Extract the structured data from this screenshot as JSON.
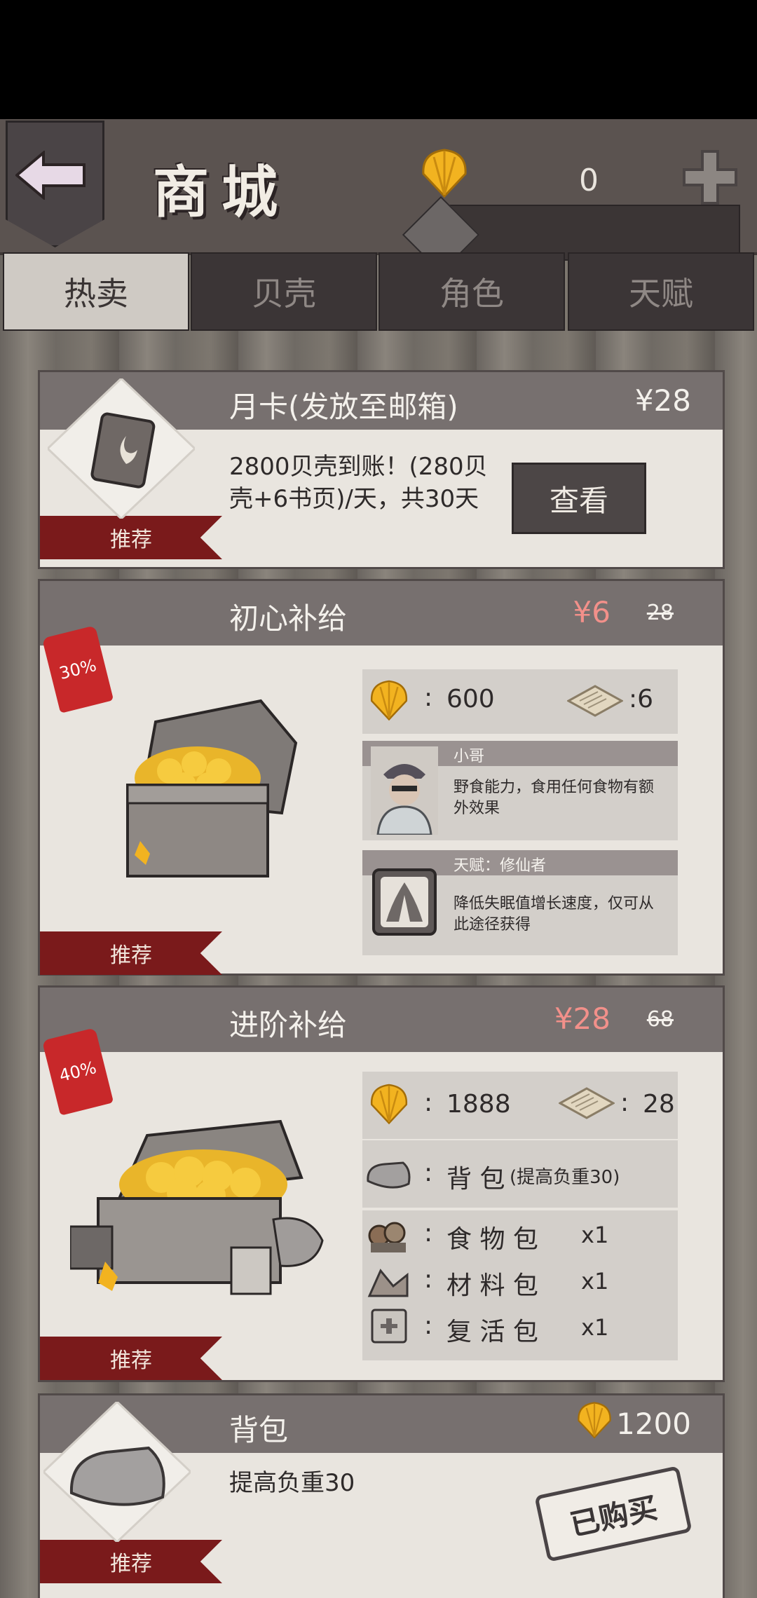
{
  "header": {
    "title": "商城",
    "shell_count": "0"
  },
  "tabs": [
    {
      "label": "热卖"
    },
    {
      "label": "贝壳"
    },
    {
      "label": "角色"
    },
    {
      "label": "天赋"
    }
  ],
  "cards": {
    "monthly": {
      "title": "月卡(发放至邮箱)",
      "price": "¥28",
      "description": "2800贝壳到账！(280贝壳+6书页)/天，共30天",
      "button": "查看",
      "ribbon": "推荐"
    },
    "starter": {
      "title": "初心补给",
      "price": "¥6",
      "old_price": "28",
      "discount": "30%",
      "ribbon": "推荐",
      "shells": "600",
      "pages": ":6",
      "character_name": "小哥",
      "character_desc": "野食能力，食用任何食物有额外效果",
      "talent_name": "天赋：修仙者",
      "talent_desc": "降低失眠值增长速度，仅可从此途径获得"
    },
    "advanced": {
      "title": "进阶补给",
      "price": "¥28",
      "old_price": "68",
      "discount": "40%",
      "ribbon": "推荐",
      "shells": "1888",
      "pages": "28",
      "backpack": "背 包",
      "backpack_note": "(提高负重30)",
      "food": "食 物 包",
      "food_qty": "x1",
      "material": "材 料 包",
      "material_qty": "x1",
      "revive": "复 活 包",
      "revive_qty": "x1"
    },
    "backpack": {
      "title": "背包",
      "price": "1200",
      "description": "提高负重30",
      "status": "已购买",
      "ribbon": "推荐"
    }
  },
  "colors": {
    "accent_sale": "#f2908a",
    "ribbon": "#7a1a1b",
    "gold": "#f2b320"
  }
}
